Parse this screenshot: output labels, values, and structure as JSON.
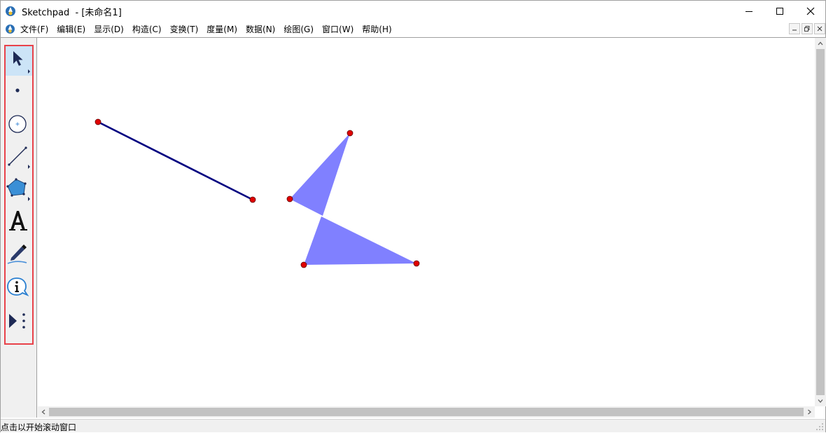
{
  "window": {
    "title": "Sketchpad  - [未命名1]"
  },
  "menu": {
    "items": [
      {
        "label": "文件(F)"
      },
      {
        "label": "编辑(E)"
      },
      {
        "label": "显示(D)"
      },
      {
        "label": "构造(C)"
      },
      {
        "label": "变换(T)"
      },
      {
        "label": "度量(M)"
      },
      {
        "label": "数据(N)"
      },
      {
        "label": "绘图(G)"
      },
      {
        "label": "窗口(W)"
      },
      {
        "label": "帮助(H)"
      }
    ]
  },
  "toolbox": {
    "tools": [
      {
        "icon": "selection-arrow-icon",
        "active": true
      },
      {
        "icon": "point-tool-icon",
        "active": false
      },
      {
        "icon": "compass-tool-icon",
        "active": false
      },
      {
        "icon": "straightedge-tool-icon",
        "active": false
      },
      {
        "icon": "polygon-tool-icon",
        "active": false
      },
      {
        "icon": "text-tool-icon",
        "active": false
      },
      {
        "icon": "marker-tool-icon",
        "active": false
      },
      {
        "icon": "information-tool-icon",
        "active": false
      },
      {
        "icon": "custom-tool-icon",
        "active": false
      }
    ],
    "highlight_color": "#e8424a"
  },
  "sketch": {
    "segment_color": "#000080",
    "polygon_fill": "#8080ff",
    "point_color": "#e00000"
  },
  "statusbar": {
    "text": "点击以开始滚动窗口"
  }
}
